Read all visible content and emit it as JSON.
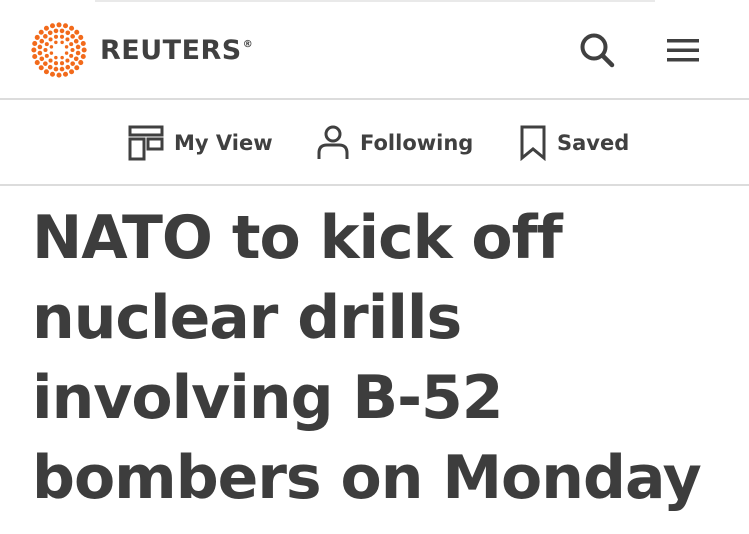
{
  "header": {
    "brand": "REUTERS",
    "registered_mark": "®",
    "logo_icon": "reuters-dot-logo-icon",
    "search_icon": "search-icon",
    "menu_icon": "hamburger-menu-icon",
    "brand_color": "#f26a1b"
  },
  "subnav": {
    "items": [
      {
        "label": "My View",
        "icon": "my-view-icon"
      },
      {
        "label": "Following",
        "icon": "person-icon"
      },
      {
        "label": "Saved",
        "icon": "bookmark-icon"
      }
    ]
  },
  "article": {
    "headline": "NATO to kick off nuclear drills involving B-52 bombers on Monday"
  }
}
